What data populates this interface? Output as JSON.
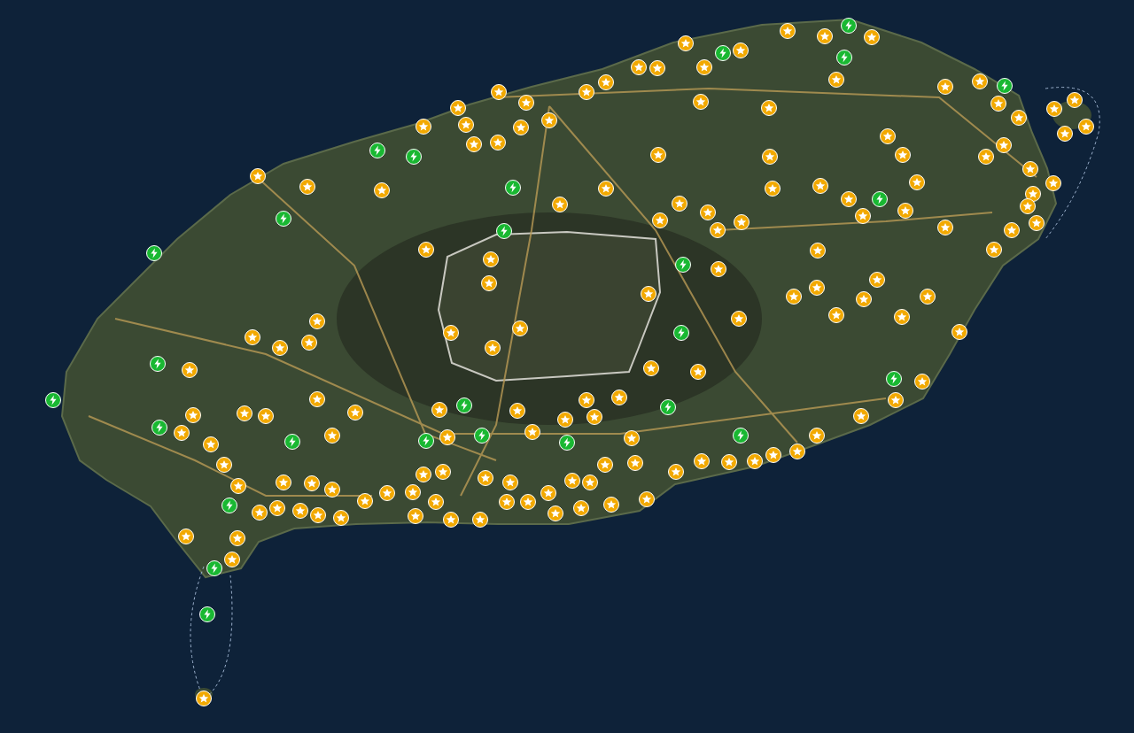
{
  "map": {
    "markers": [
      {
        "kind": "charger"
      },
      {
        "kind": "charger"
      },
      {
        "kind": "charger"
      },
      {
        "kind": "charger"
      },
      {
        "kind": "charger"
      },
      {
        "kind": "charger"
      },
      {
        "kind": "charger"
      },
      {
        "kind": "charger"
      },
      {
        "kind": "charger"
      },
      {
        "kind": "charger"
      },
      {
        "kind": "charger"
      },
      {
        "kind": "charger"
      },
      {
        "kind": "charger"
      },
      {
        "kind": "charger"
      },
      {
        "kind": "charger"
      },
      {
        "kind": "charger"
      },
      {
        "kind": "charger"
      },
      {
        "kind": "charger"
      },
      {
        "kind": "charger"
      },
      {
        "kind": "charger"
      },
      {
        "kind": "charger"
      },
      {
        "kind": "charger"
      },
      {
        "kind": "charger"
      },
      {
        "kind": "charger"
      },
      {
        "kind": "charger"
      },
      {
        "kind": "charger"
      },
      {
        "kind": "charger"
      },
      {
        "kind": "star"
      },
      {
        "kind": "star"
      },
      {
        "kind": "star"
      },
      {
        "kind": "star"
      },
      {
        "kind": "star"
      },
      {
        "kind": "star"
      },
      {
        "kind": "star"
      },
      {
        "kind": "star"
      },
      {
        "kind": "star"
      },
      {
        "kind": "star"
      },
      {
        "kind": "star"
      },
      {
        "kind": "star"
      },
      {
        "kind": "star"
      },
      {
        "kind": "star"
      },
      {
        "kind": "star"
      },
      {
        "kind": "star"
      },
      {
        "kind": "star"
      },
      {
        "kind": "star"
      },
      {
        "kind": "star"
      },
      {
        "kind": "star"
      },
      {
        "kind": "star"
      },
      {
        "kind": "star"
      },
      {
        "kind": "star"
      },
      {
        "kind": "star"
      },
      {
        "kind": "star"
      },
      {
        "kind": "star"
      },
      {
        "kind": "star"
      },
      {
        "kind": "star"
      },
      {
        "kind": "star"
      },
      {
        "kind": "star"
      },
      {
        "kind": "star"
      },
      {
        "kind": "star"
      },
      {
        "kind": "star"
      },
      {
        "kind": "star"
      },
      {
        "kind": "star"
      },
      {
        "kind": "star"
      },
      {
        "kind": "star"
      },
      {
        "kind": "star"
      },
      {
        "kind": "star"
      },
      {
        "kind": "star"
      },
      {
        "kind": "star"
      },
      {
        "kind": "star"
      },
      {
        "kind": "star"
      },
      {
        "kind": "star"
      },
      {
        "kind": "star"
      },
      {
        "kind": "star"
      },
      {
        "kind": "star"
      },
      {
        "kind": "star"
      },
      {
        "kind": "star"
      },
      {
        "kind": "star"
      },
      {
        "kind": "star"
      },
      {
        "kind": "star"
      },
      {
        "kind": "star"
      },
      {
        "kind": "star"
      },
      {
        "kind": "star"
      },
      {
        "kind": "star"
      },
      {
        "kind": "star"
      },
      {
        "kind": "star"
      },
      {
        "kind": "star"
      },
      {
        "kind": "star"
      },
      {
        "kind": "star"
      },
      {
        "kind": "star"
      },
      {
        "kind": "star"
      },
      {
        "kind": "star"
      },
      {
        "kind": "star"
      },
      {
        "kind": "star"
      },
      {
        "kind": "star"
      },
      {
        "kind": "star"
      },
      {
        "kind": "star"
      },
      {
        "kind": "star"
      },
      {
        "kind": "star"
      },
      {
        "kind": "star"
      },
      {
        "kind": "star"
      },
      {
        "kind": "star"
      },
      {
        "kind": "star"
      },
      {
        "kind": "star"
      },
      {
        "kind": "star"
      },
      {
        "kind": "star"
      },
      {
        "kind": "star"
      },
      {
        "kind": "star"
      },
      {
        "kind": "star"
      },
      {
        "kind": "star"
      },
      {
        "kind": "star"
      },
      {
        "kind": "star"
      },
      {
        "kind": "star"
      },
      {
        "kind": "star"
      },
      {
        "kind": "star"
      },
      {
        "kind": "star"
      },
      {
        "kind": "star"
      },
      {
        "kind": "star"
      },
      {
        "kind": "star"
      },
      {
        "kind": "star"
      },
      {
        "kind": "star"
      },
      {
        "kind": "star"
      },
      {
        "kind": "star"
      },
      {
        "kind": "star"
      },
      {
        "kind": "star"
      },
      {
        "kind": "star"
      },
      {
        "kind": "star"
      },
      {
        "kind": "star"
      },
      {
        "kind": "star"
      },
      {
        "kind": "star"
      },
      {
        "kind": "star"
      },
      {
        "kind": "star"
      },
      {
        "kind": "star"
      },
      {
        "kind": "star"
      },
      {
        "kind": "star"
      },
      {
        "kind": "star"
      },
      {
        "kind": "star"
      },
      {
        "kind": "star"
      },
      {
        "kind": "star"
      },
      {
        "kind": "star"
      },
      {
        "kind": "star"
      },
      {
        "kind": "star"
      },
      {
        "kind": "star"
      },
      {
        "kind": "star"
      },
      {
        "kind": "star"
      },
      {
        "kind": "star"
      },
      {
        "kind": "star"
      },
      {
        "kind": "star"
      },
      {
        "kind": "star"
      },
      {
        "kind": "star"
      },
      {
        "kind": "star"
      },
      {
        "kind": "star"
      },
      {
        "kind": "star"
      },
      {
        "kind": "star"
      },
      {
        "kind": "star"
      },
      {
        "kind": "star"
      },
      {
        "kind": "star"
      },
      {
        "kind": "star"
      },
      {
        "kind": "star"
      },
      {
        "kind": "star"
      },
      {
        "kind": "star"
      },
      {
        "kind": "star"
      },
      {
        "kind": "star"
      },
      {
        "kind": "star"
      },
      {
        "kind": "star"
      },
      {
        "kind": "star"
      },
      {
        "kind": "star"
      },
      {
        "kind": "star"
      },
      {
        "kind": "star"
      },
      {
        "kind": "star"
      },
      {
        "kind": "star"
      },
      {
        "kind": "star"
      },
      {
        "kind": "star"
      },
      {
        "kind": "star"
      },
      {
        "kind": "star"
      },
      {
        "kind": "star"
      }
    ]
  }
}
